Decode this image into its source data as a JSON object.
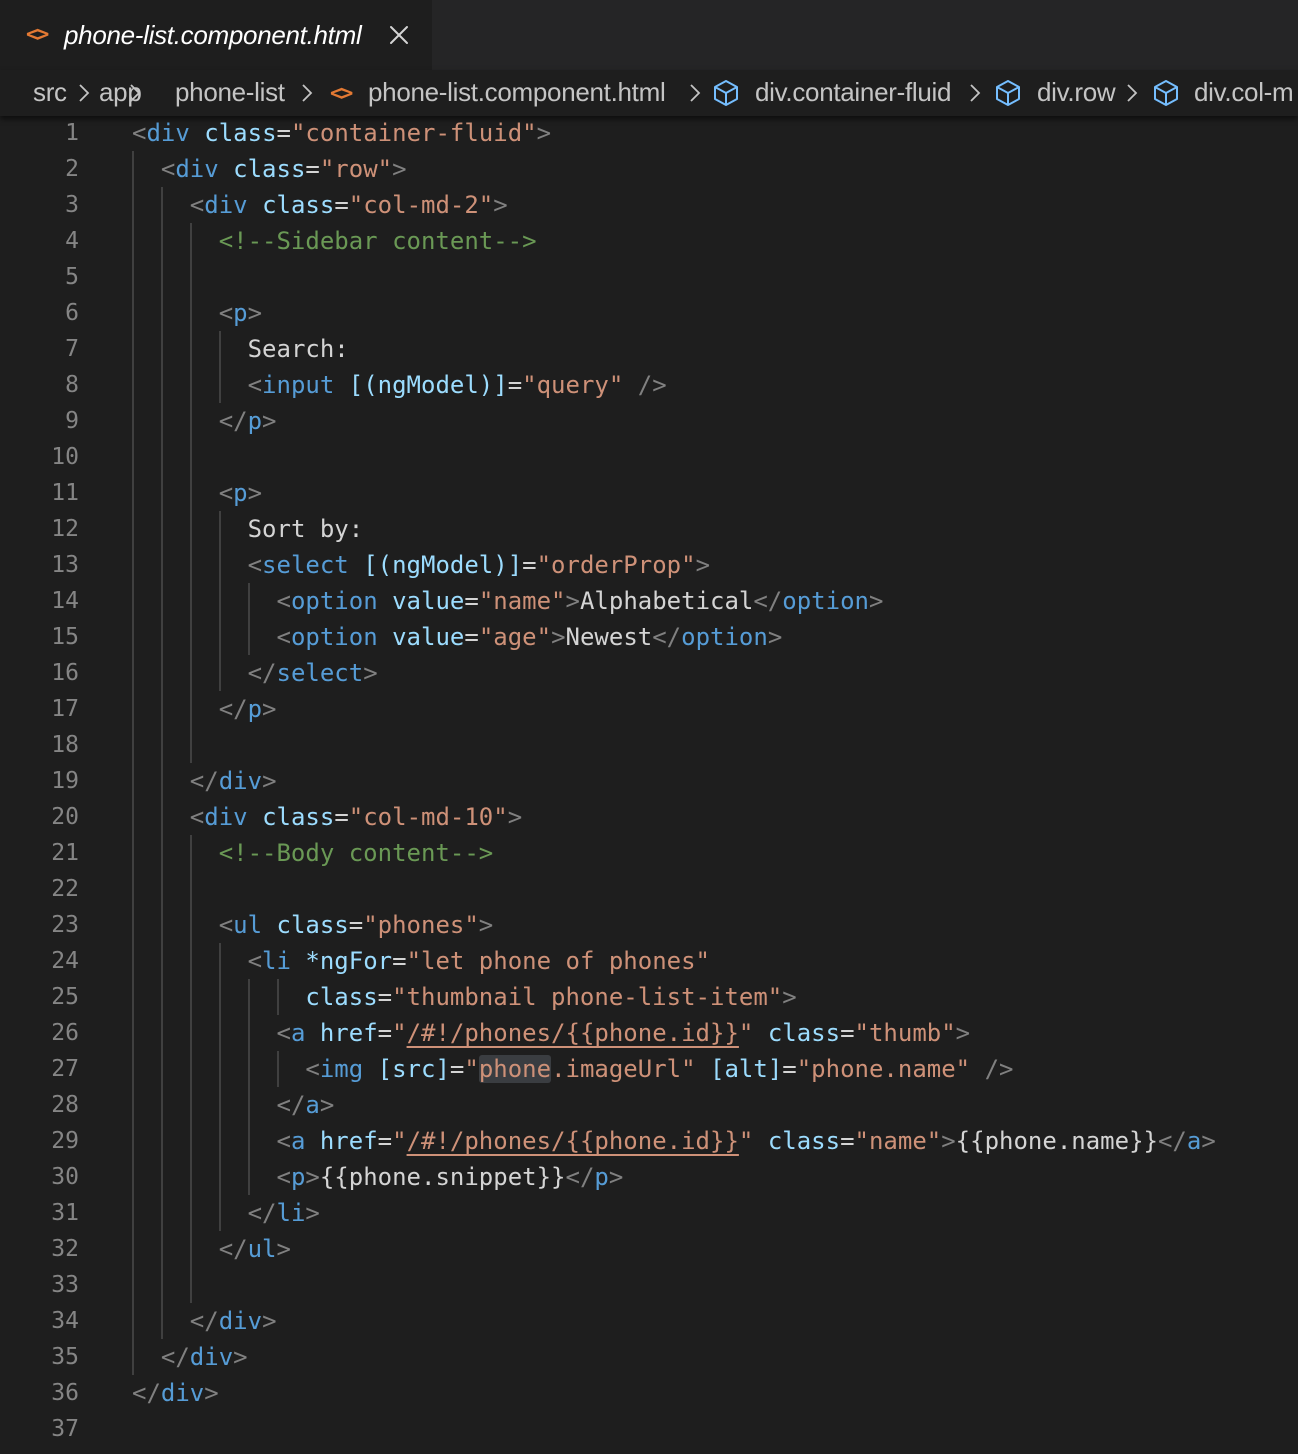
{
  "tab": {
    "icon": "html-file-icon",
    "label": "phone-list.component.html",
    "close_icon": "close-icon"
  },
  "breadcrumb": {
    "items": [
      {
        "label": "src",
        "icon": ""
      },
      {
        "label": "app",
        "icon": ""
      },
      {
        "label": "phone-list",
        "icon": ""
      },
      {
        "label": "phone-list.component.html",
        "icon": "html-file-icon"
      },
      {
        "label": "div.container-fluid",
        "icon": "symbol-element-icon"
      },
      {
        "label": "div.row",
        "icon": "symbol-element-icon"
      },
      {
        "label": "div.col-m",
        "icon": "symbol-element-icon"
      }
    ]
  },
  "colors": {
    "tag": "#569cd6",
    "attribute": "#9cdcfe",
    "string": "#ce9178",
    "comment": "#6a9955",
    "punctuation": "#808080",
    "text": "#d4d4d4",
    "file_icon": "#e37933",
    "symbol_icon": "#75beff"
  },
  "editor": {
    "lines": [
      {
        "num": "1",
        "indent": 0,
        "tokens": [
          {
            "t": "p",
            "v": "<"
          },
          {
            "t": "tag",
            "v": "div"
          },
          {
            "t": "text",
            "v": " "
          },
          {
            "t": "attr",
            "v": "class"
          },
          {
            "t": "text",
            "v": "="
          },
          {
            "t": "str",
            "v": "\"container-fluid\""
          },
          {
            "t": "p",
            "v": ">"
          }
        ]
      },
      {
        "num": "2",
        "indent": 1,
        "tokens": [
          {
            "t": "p",
            "v": "<"
          },
          {
            "t": "tag",
            "v": "div"
          },
          {
            "t": "text",
            "v": " "
          },
          {
            "t": "attr",
            "v": "class"
          },
          {
            "t": "text",
            "v": "="
          },
          {
            "t": "str",
            "v": "\"row\""
          },
          {
            "t": "p",
            "v": ">"
          }
        ]
      },
      {
        "num": "3",
        "indent": 2,
        "tokens": [
          {
            "t": "p",
            "v": "<"
          },
          {
            "t": "tag",
            "v": "div"
          },
          {
            "t": "text",
            "v": " "
          },
          {
            "t": "attr",
            "v": "class"
          },
          {
            "t": "text",
            "v": "="
          },
          {
            "t": "str",
            "v": "\"col-md-2\""
          },
          {
            "t": "p",
            "v": ">"
          }
        ]
      },
      {
        "num": "4",
        "indent": 3,
        "tokens": [
          {
            "t": "com",
            "v": "<!--Sidebar content-->"
          }
        ]
      },
      {
        "num": "5",
        "indent": 0,
        "tokens": []
      },
      {
        "num": "6",
        "indent": 3,
        "tokens": [
          {
            "t": "p",
            "v": "<"
          },
          {
            "t": "tag",
            "v": "p"
          },
          {
            "t": "p",
            "v": ">"
          }
        ]
      },
      {
        "num": "7",
        "indent": 4,
        "tokens": [
          {
            "t": "text",
            "v": "Search:"
          }
        ]
      },
      {
        "num": "8",
        "indent": 4,
        "tokens": [
          {
            "t": "p",
            "v": "<"
          },
          {
            "t": "tag",
            "v": "input"
          },
          {
            "t": "text",
            "v": " "
          },
          {
            "t": "attr",
            "v": "[(ngModel)]"
          },
          {
            "t": "text",
            "v": "="
          },
          {
            "t": "str",
            "v": "\"query\""
          },
          {
            "t": "text",
            "v": " "
          },
          {
            "t": "p",
            "v": "/>"
          }
        ]
      },
      {
        "num": "9",
        "indent": 3,
        "tokens": [
          {
            "t": "p",
            "v": "</"
          },
          {
            "t": "tag",
            "v": "p"
          },
          {
            "t": "p",
            "v": ">"
          }
        ]
      },
      {
        "num": "10",
        "indent": 0,
        "tokens": []
      },
      {
        "num": "11",
        "indent": 3,
        "tokens": [
          {
            "t": "p",
            "v": "<"
          },
          {
            "t": "tag",
            "v": "p"
          },
          {
            "t": "p",
            "v": ">"
          }
        ]
      },
      {
        "num": "12",
        "indent": 4,
        "tokens": [
          {
            "t": "text",
            "v": "Sort by:"
          }
        ]
      },
      {
        "num": "13",
        "indent": 4,
        "tokens": [
          {
            "t": "p",
            "v": "<"
          },
          {
            "t": "tag",
            "v": "select"
          },
          {
            "t": "text",
            "v": " "
          },
          {
            "t": "attr",
            "v": "[(ngModel)]"
          },
          {
            "t": "text",
            "v": "="
          },
          {
            "t": "str",
            "v": "\"orderProp\""
          },
          {
            "t": "p",
            "v": ">"
          }
        ]
      },
      {
        "num": "14",
        "indent": 5,
        "tokens": [
          {
            "t": "p",
            "v": "<"
          },
          {
            "t": "tag",
            "v": "option"
          },
          {
            "t": "text",
            "v": " "
          },
          {
            "t": "attr",
            "v": "value"
          },
          {
            "t": "text",
            "v": "="
          },
          {
            "t": "str",
            "v": "\"name\""
          },
          {
            "t": "p",
            "v": ">"
          },
          {
            "t": "text",
            "v": "Alphabetical"
          },
          {
            "t": "p",
            "v": "</"
          },
          {
            "t": "tag",
            "v": "option"
          },
          {
            "t": "p",
            "v": ">"
          }
        ]
      },
      {
        "num": "15",
        "indent": 5,
        "tokens": [
          {
            "t": "p",
            "v": "<"
          },
          {
            "t": "tag",
            "v": "option"
          },
          {
            "t": "text",
            "v": " "
          },
          {
            "t": "attr",
            "v": "value"
          },
          {
            "t": "text",
            "v": "="
          },
          {
            "t": "str",
            "v": "\"age\""
          },
          {
            "t": "p",
            "v": ">"
          },
          {
            "t": "text",
            "v": "Newest"
          },
          {
            "t": "p",
            "v": "</"
          },
          {
            "t": "tag",
            "v": "option"
          },
          {
            "t": "p",
            "v": ">"
          }
        ]
      },
      {
        "num": "16",
        "indent": 4,
        "tokens": [
          {
            "t": "p",
            "v": "</"
          },
          {
            "t": "tag",
            "v": "select"
          },
          {
            "t": "p",
            "v": ">"
          }
        ]
      },
      {
        "num": "17",
        "indent": 3,
        "tokens": [
          {
            "t": "p",
            "v": "</"
          },
          {
            "t": "tag",
            "v": "p"
          },
          {
            "t": "p",
            "v": ">"
          }
        ]
      },
      {
        "num": "18",
        "indent": 0,
        "tokens": []
      },
      {
        "num": "19",
        "indent": 2,
        "tokens": [
          {
            "t": "p",
            "v": "</"
          },
          {
            "t": "tag",
            "v": "div"
          },
          {
            "t": "p",
            "v": ">"
          }
        ]
      },
      {
        "num": "20",
        "indent": 2,
        "tokens": [
          {
            "t": "p",
            "v": "<"
          },
          {
            "t": "tag",
            "v": "div"
          },
          {
            "t": "text",
            "v": " "
          },
          {
            "t": "attr",
            "v": "class"
          },
          {
            "t": "text",
            "v": "="
          },
          {
            "t": "str",
            "v": "\"col-md-10\""
          },
          {
            "t": "p",
            "v": ">"
          }
        ]
      },
      {
        "num": "21",
        "indent": 3,
        "tokens": [
          {
            "t": "com",
            "v": "<!--Body content-->"
          }
        ]
      },
      {
        "num": "22",
        "indent": 0,
        "tokens": []
      },
      {
        "num": "23",
        "indent": 3,
        "tokens": [
          {
            "t": "p",
            "v": "<"
          },
          {
            "t": "tag",
            "v": "ul"
          },
          {
            "t": "text",
            "v": " "
          },
          {
            "t": "attr",
            "v": "class"
          },
          {
            "t": "text",
            "v": "="
          },
          {
            "t": "str",
            "v": "\"phones\""
          },
          {
            "t": "p",
            "v": ">"
          }
        ]
      },
      {
        "num": "24",
        "indent": 4,
        "tokens": [
          {
            "t": "p",
            "v": "<"
          },
          {
            "t": "tag",
            "v": "li"
          },
          {
            "t": "text",
            "v": " "
          },
          {
            "t": "attr",
            "v": "*ngFor"
          },
          {
            "t": "text",
            "v": "="
          },
          {
            "t": "str",
            "v": "\"let phone of phones\""
          }
        ]
      },
      {
        "num": "25",
        "indent": 6,
        "tokens": [
          {
            "t": "attr",
            "v": "class"
          },
          {
            "t": "text",
            "v": "="
          },
          {
            "t": "str",
            "v": "\"thumbnail phone-list-item\""
          },
          {
            "t": "p",
            "v": ">"
          }
        ]
      },
      {
        "num": "26",
        "indent": 5,
        "tokens": [
          {
            "t": "p",
            "v": "<"
          },
          {
            "t": "tag",
            "v": "a"
          },
          {
            "t": "text",
            "v": " "
          },
          {
            "t": "attr",
            "v": "href"
          },
          {
            "t": "text",
            "v": "="
          },
          {
            "t": "str",
            "v": "\""
          },
          {
            "t": "link",
            "v": "/#!/phones/{{phone.id}}"
          },
          {
            "t": "str",
            "v": "\""
          },
          {
            "t": "text",
            "v": " "
          },
          {
            "t": "attr",
            "v": "class"
          },
          {
            "t": "text",
            "v": "="
          },
          {
            "t": "str",
            "v": "\"thumb\""
          },
          {
            "t": "p",
            "v": ">"
          }
        ]
      },
      {
        "num": "27",
        "indent": 6,
        "tokens": [
          {
            "t": "p",
            "v": "<"
          },
          {
            "t": "tag",
            "v": "img"
          },
          {
            "t": "text",
            "v": " "
          },
          {
            "t": "attr",
            "v": "[src]"
          },
          {
            "t": "text",
            "v": "="
          },
          {
            "t": "str",
            "v": "\""
          },
          {
            "t": "hl",
            "v": "phone"
          },
          {
            "t": "str",
            "v": ".imageUrl\""
          },
          {
            "t": "text",
            "v": " "
          },
          {
            "t": "attr",
            "v": "[alt]"
          },
          {
            "t": "text",
            "v": "="
          },
          {
            "t": "str",
            "v": "\"phone.name\""
          },
          {
            "t": "text",
            "v": " "
          },
          {
            "t": "p",
            "v": "/>"
          }
        ]
      },
      {
        "num": "28",
        "indent": 5,
        "tokens": [
          {
            "t": "p",
            "v": "</"
          },
          {
            "t": "tag",
            "v": "a"
          },
          {
            "t": "p",
            "v": ">"
          }
        ]
      },
      {
        "num": "29",
        "indent": 5,
        "tokens": [
          {
            "t": "p",
            "v": "<"
          },
          {
            "t": "tag",
            "v": "a"
          },
          {
            "t": "text",
            "v": " "
          },
          {
            "t": "attr",
            "v": "href"
          },
          {
            "t": "text",
            "v": "="
          },
          {
            "t": "str",
            "v": "\""
          },
          {
            "t": "link",
            "v": "/#!/phones/{{phone.id}}"
          },
          {
            "t": "str",
            "v": "\""
          },
          {
            "t": "text",
            "v": " "
          },
          {
            "t": "attr",
            "v": "class"
          },
          {
            "t": "text",
            "v": "="
          },
          {
            "t": "str",
            "v": "\"name\""
          },
          {
            "t": "p",
            "v": ">"
          },
          {
            "t": "text",
            "v": "{{phone.name}}"
          },
          {
            "t": "p",
            "v": "</"
          },
          {
            "t": "tag",
            "v": "a"
          },
          {
            "t": "p",
            "v": ">"
          }
        ]
      },
      {
        "num": "30",
        "indent": 5,
        "tokens": [
          {
            "t": "p",
            "v": "<"
          },
          {
            "t": "tag",
            "v": "p"
          },
          {
            "t": "p",
            "v": ">"
          },
          {
            "t": "text",
            "v": "{{phone.snippet}}"
          },
          {
            "t": "p",
            "v": "</"
          },
          {
            "t": "tag",
            "v": "p"
          },
          {
            "t": "p",
            "v": ">"
          }
        ]
      },
      {
        "num": "31",
        "indent": 4,
        "tokens": [
          {
            "t": "p",
            "v": "</"
          },
          {
            "t": "tag",
            "v": "li"
          },
          {
            "t": "p",
            "v": ">"
          }
        ]
      },
      {
        "num": "32",
        "indent": 3,
        "tokens": [
          {
            "t": "p",
            "v": "</"
          },
          {
            "t": "tag",
            "v": "ul"
          },
          {
            "t": "p",
            "v": ">"
          }
        ]
      },
      {
        "num": "33",
        "indent": 0,
        "tokens": []
      },
      {
        "num": "34",
        "indent": 2,
        "tokens": [
          {
            "t": "p",
            "v": "</"
          },
          {
            "t": "tag",
            "v": "div"
          },
          {
            "t": "p",
            "v": ">"
          }
        ]
      },
      {
        "num": "35",
        "indent": 1,
        "tokens": [
          {
            "t": "p",
            "v": "</"
          },
          {
            "t": "tag",
            "v": "div"
          },
          {
            "t": "p",
            "v": ">"
          }
        ]
      },
      {
        "num": "36",
        "indent": 0,
        "tokens": [
          {
            "t": "p",
            "v": "</"
          },
          {
            "t": "tag",
            "v": "div"
          },
          {
            "t": "p",
            "v": ">"
          }
        ]
      },
      {
        "num": "37",
        "indent": 0,
        "tokens": []
      }
    ]
  }
}
